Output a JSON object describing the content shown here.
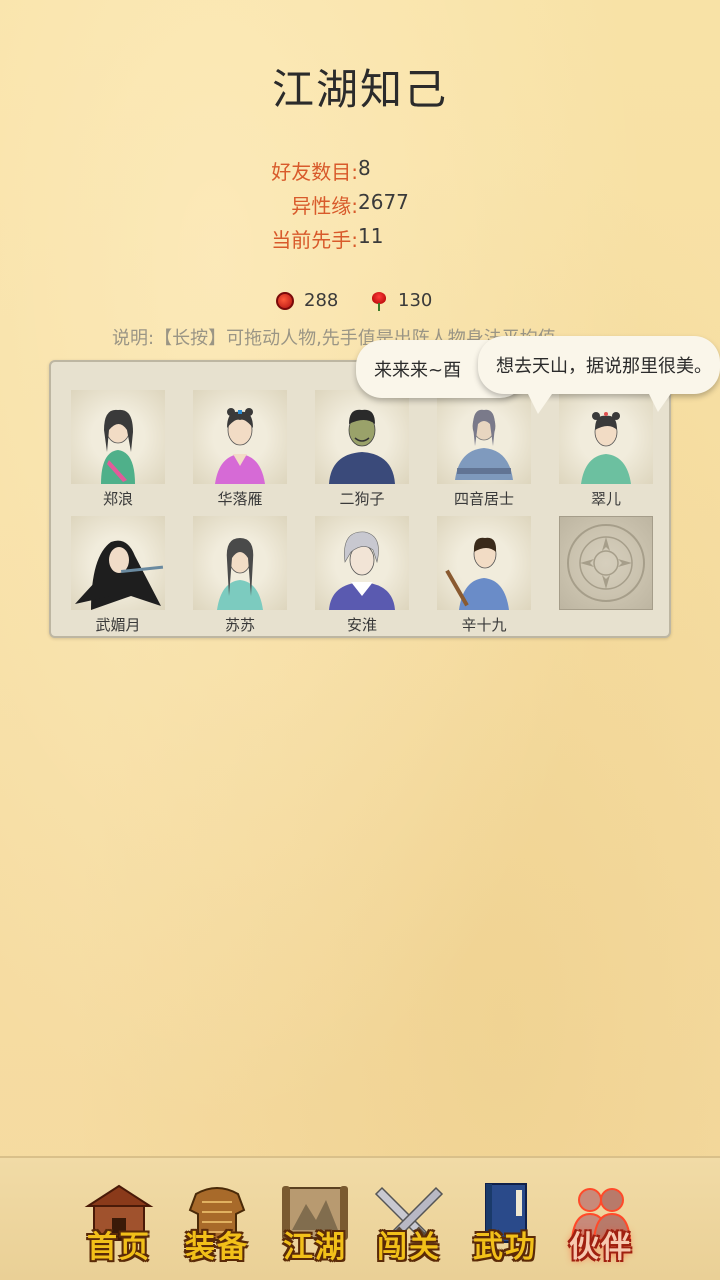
{
  "page": {
    "title": "江湖知己"
  },
  "stats": [
    {
      "label": "好友数目:",
      "value": "8"
    },
    {
      "label": "异性缘:",
      "value": "2677"
    },
    {
      "label": "当前先手:",
      "value": "11"
    }
  ],
  "currency": [
    {
      "icon": "coin-icon",
      "value": "288"
    },
    {
      "icon": "rose-icon",
      "value": "130"
    }
  ],
  "description": "说明:【长按】可拖动人物,先手值是出阵人物身法平均值",
  "characters": [
    {
      "name": "郑浪"
    },
    {
      "name": "华落雁"
    },
    {
      "name": "二狗子"
    },
    {
      "name": "四音居士"
    },
    {
      "name": "翠儿"
    },
    {
      "name": "武媚月"
    },
    {
      "name": "苏苏"
    },
    {
      "name": "安淮"
    },
    {
      "name": "辛十九"
    }
  ],
  "bubbles": [
    {
      "text": "来来来~酉"
    },
    {
      "text": "想去天山，据说那里很美。"
    }
  ],
  "nav": [
    {
      "label": "首页",
      "icon": "house-icon",
      "active": false
    },
    {
      "label": "装备",
      "icon": "armor-icon",
      "active": false
    },
    {
      "label": "江湖",
      "icon": "scroll-map-icon",
      "active": false
    },
    {
      "label": "闯关",
      "icon": "crossed-swords-icon",
      "active": false
    },
    {
      "label": "武功",
      "icon": "book-icon",
      "active": false
    },
    {
      "label": "伙伴",
      "icon": "partners-icon",
      "active": true
    }
  ]
}
